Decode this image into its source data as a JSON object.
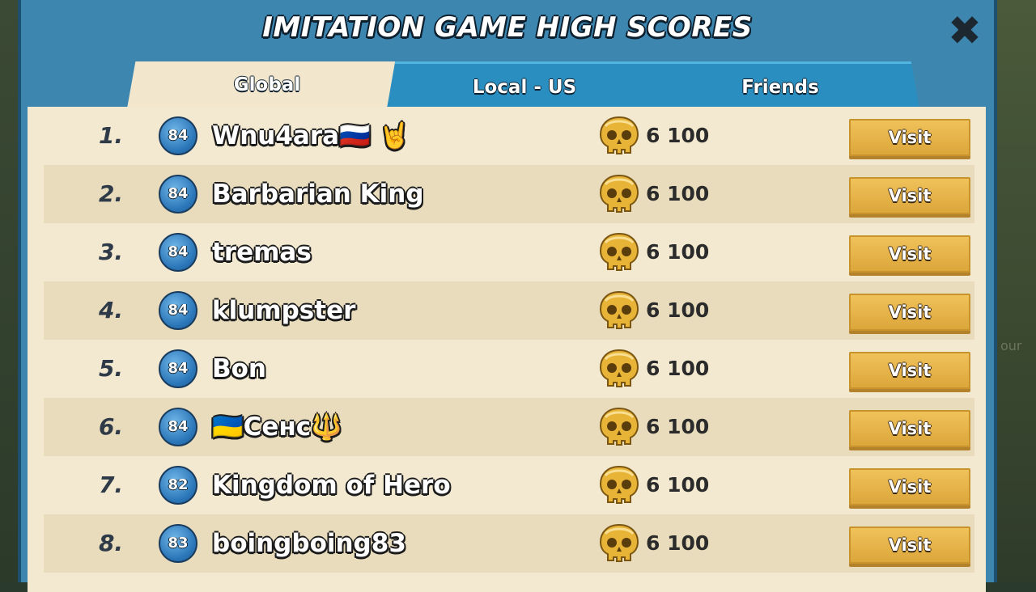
{
  "title": "IMITATION GAME HIGH SCORES",
  "close_icon": "close-icon",
  "background_text": "our",
  "tabs": [
    {
      "label": "Global",
      "active": true
    },
    {
      "label": "Local - US",
      "active": false
    },
    {
      "label": "Friends",
      "active": false
    }
  ],
  "rows": [
    {
      "rank": "1.",
      "level": "84",
      "name": "Wnu4ara🇷🇺 🤘",
      "score": "6 100",
      "action": "Visit"
    },
    {
      "rank": "2.",
      "level": "84",
      "name": "Barbarian King",
      "score": "6 100",
      "action": "Visit"
    },
    {
      "rank": "3.",
      "level": "84",
      "name": "tremas",
      "score": "6 100",
      "action": "Visit"
    },
    {
      "rank": "4.",
      "level": "84",
      "name": "klumpster",
      "score": "6 100",
      "action": "Visit"
    },
    {
      "rank": "5.",
      "level": "84",
      "name": "Bon",
      "score": "6 100",
      "action": "Visit"
    },
    {
      "rank": "6.",
      "level": "84",
      "name": "🇺🇦Сенс🔱",
      "score": "6 100",
      "action": "Visit"
    },
    {
      "rank": "7.",
      "level": "82",
      "name": "Kingdom of Hero",
      "score": "6 100",
      "action": "Visit"
    },
    {
      "rank": "8.",
      "level": "83",
      "name": "boingboing83",
      "score": "6 100",
      "action": "Visit"
    }
  ],
  "colors": {
    "frame": "#3d86b0",
    "board": "#f3e9d0",
    "board_alt_row": "#e8dcbc",
    "visit_button": "#e8b54a"
  }
}
